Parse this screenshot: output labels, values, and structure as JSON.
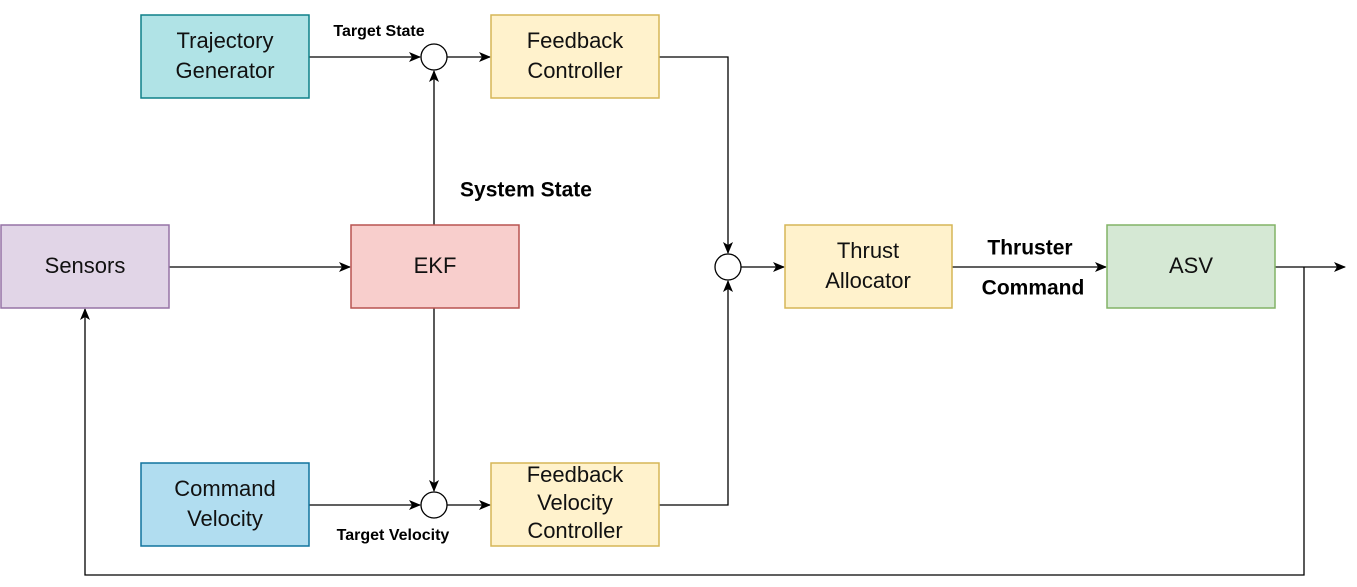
{
  "nodes": {
    "trajectory_generator": {
      "line1": "Trajectory",
      "line2": "Generator",
      "fill": "#b0e3e6",
      "stroke": "#0e8088"
    },
    "feedback_controller": {
      "line1": "Feedback",
      "line2": "Controller",
      "fill": "#fff2cc",
      "stroke": "#d6b656"
    },
    "sensors": {
      "label": "Sensors",
      "fill": "#e1d5e7",
      "stroke": "#9673a6"
    },
    "ekf": {
      "label": "EKF",
      "fill": "#f8cecc",
      "stroke": "#b85450"
    },
    "thrust_allocator": {
      "line1": "Thrust",
      "line2": "Allocator",
      "fill": "#fff2cc",
      "stroke": "#d6b656"
    },
    "asv": {
      "label": "ASV",
      "fill": "#d5e8d4",
      "stroke": "#82b366"
    },
    "command_velocity": {
      "line1": "Command",
      "line2": "Velocity",
      "fill": "#b1ddf0",
      "stroke": "#10739e"
    },
    "feedback_velocity_controller": {
      "line1": "Feedback",
      "line2": "Velocity",
      "line3": "Controller",
      "fill": "#fff2cc",
      "stroke": "#d6b656"
    }
  },
  "edge_labels": {
    "target_state": "Target State",
    "system_state": "System State",
    "thruster_command_1": "Thruster",
    "thruster_command_2": "Command",
    "target_velocity": "Target Velocity"
  }
}
